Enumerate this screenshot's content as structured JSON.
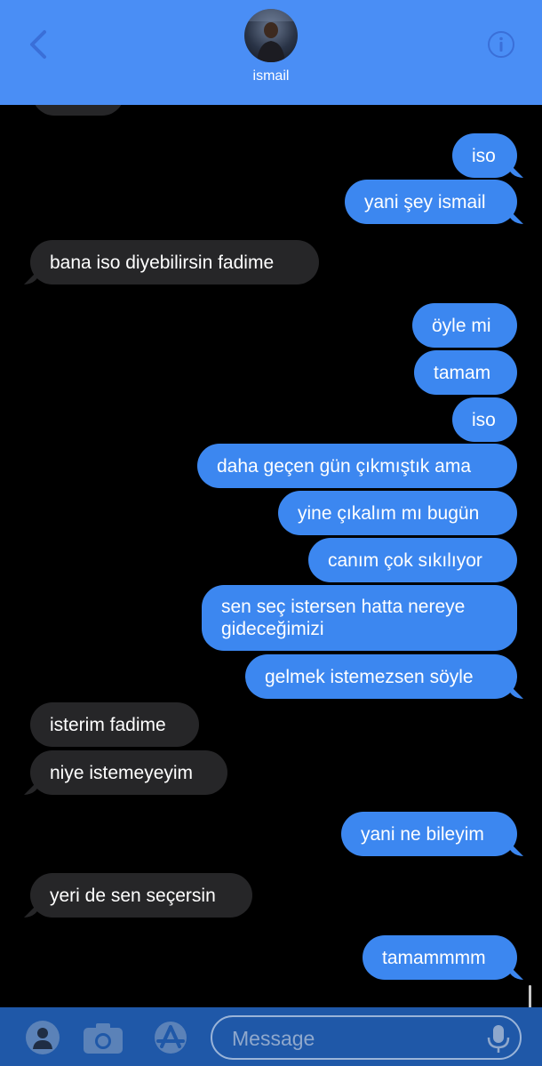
{
  "header": {
    "contact_name": "ismail",
    "back_icon": "chevron-left-icon",
    "info_icon": "info-icon",
    "color": "#4a8ef5"
  },
  "messages": [
    {
      "dir": "out",
      "text": "iso"
    },
    {
      "dir": "out",
      "text": "yani şey ismail"
    },
    {
      "dir": "in",
      "text": "bana iso diyebilirsin fadime"
    },
    {
      "dir": "out",
      "text": "öyle mi"
    },
    {
      "dir": "out",
      "text": "tamam"
    },
    {
      "dir": "out",
      "text": "iso"
    },
    {
      "dir": "out",
      "text": "daha geçen gün çıkmıştık ama"
    },
    {
      "dir": "out",
      "text": "yine çıkalım mı bugün"
    },
    {
      "dir": "out",
      "text": "canım çok sıkılıyor"
    },
    {
      "dir": "out",
      "text": "sen seç istersen hatta nereye gideceğimizi"
    },
    {
      "dir": "out",
      "text": "gelmek istemezsen söyle"
    },
    {
      "dir": "in",
      "text": "isterim fadime"
    },
    {
      "dir": "in",
      "text": "niye istemeyeyim"
    },
    {
      "dir": "out",
      "text": "yani ne bileyim"
    },
    {
      "dir": "in",
      "text": "yeri de sen seçersin"
    },
    {
      "dir": "out",
      "text": "tamammmm"
    }
  ],
  "composer": {
    "placeholder": "Message",
    "icons": [
      "memoji-icon",
      "camera-icon",
      "app-store-icon",
      "microphone-icon"
    ]
  },
  "colors": {
    "outgoing": "#3c87f0",
    "incoming": "#262628",
    "bottom_bar": "#1f58a8"
  }
}
